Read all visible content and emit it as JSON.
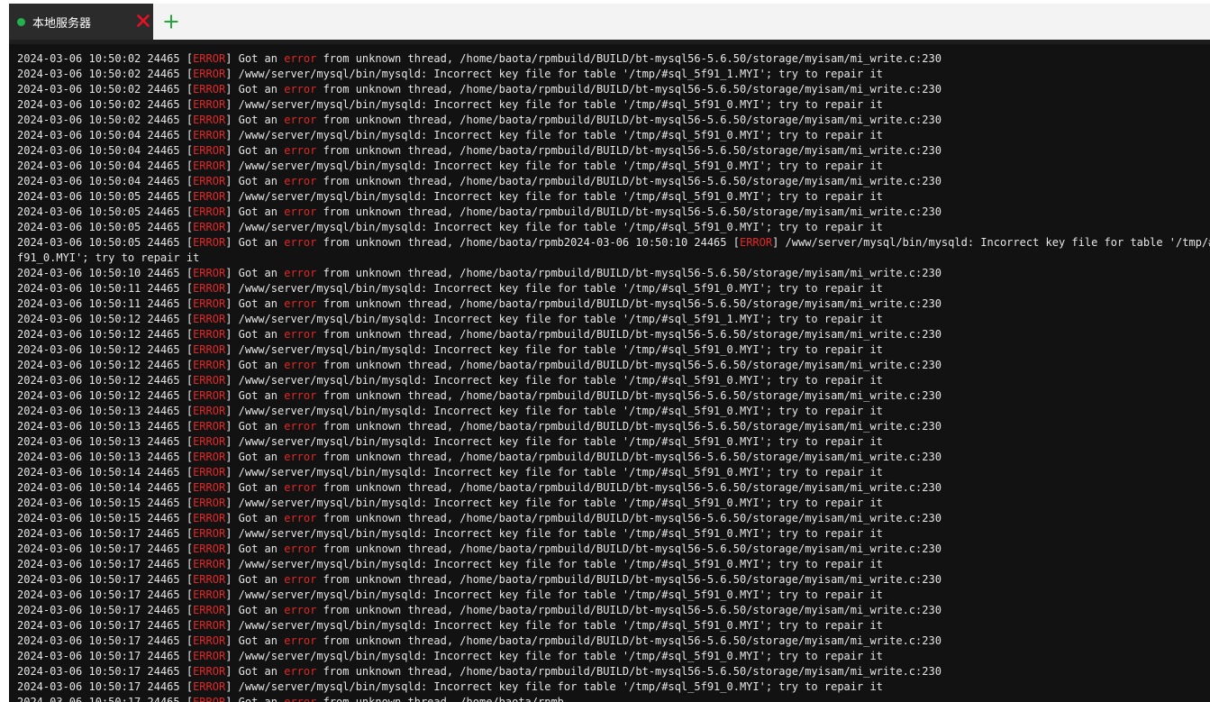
{
  "tab": {
    "label": "本地服务器",
    "status_color": "#22b14c",
    "close_icon": "close-icon",
    "add_icon": "plus-icon"
  },
  "colors": {
    "terminal_bg": "#121212",
    "text": "#e6e6e6",
    "error_red": "#e02828"
  },
  "lines": [
    [
      "2024-03-06 10:50:02 24465 [",
      {
        "r": "ERROR"
      },
      "] Got an ",
      {
        "r": "error"
      },
      " from unknown thread, /home/baota/rpmbuild/BUILD/bt-mysql56-5.6.50/storage/myisam/mi_write.c:230"
    ],
    [
      "2024-03-06 10:50:02 24465 [",
      {
        "r": "ERROR"
      },
      "] /www/server/mysql/bin/mysqld: Incorrect key file for table '/tmp/#sql_5f91_1.MYI'; try to repair it"
    ],
    [
      "2024-03-06 10:50:02 24465 [",
      {
        "r": "ERROR"
      },
      "] Got an ",
      {
        "r": "error"
      },
      " from unknown thread, /home/baota/rpmbuild/BUILD/bt-mysql56-5.6.50/storage/myisam/mi_write.c:230"
    ],
    [
      "2024-03-06 10:50:02 24465 [",
      {
        "r": "ERROR"
      },
      "] /www/server/mysql/bin/mysqld: Incorrect key file for table '/tmp/#sql_5f91_0.MYI'; try to repair it"
    ],
    [
      "2024-03-06 10:50:02 24465 [",
      {
        "r": "ERROR"
      },
      "] Got an ",
      {
        "r": "error"
      },
      " from unknown thread, /home/baota/rpmbuild/BUILD/bt-mysql56-5.6.50/storage/myisam/mi_write.c:230"
    ],
    [
      "2024-03-06 10:50:04 24465 [",
      {
        "r": "ERROR"
      },
      "] /www/server/mysql/bin/mysqld: Incorrect key file for table '/tmp/#sql_5f91_0.MYI'; try to repair it"
    ],
    [
      "2024-03-06 10:50:04 24465 [",
      {
        "r": "ERROR"
      },
      "] Got an ",
      {
        "r": "error"
      },
      " from unknown thread, /home/baota/rpmbuild/BUILD/bt-mysql56-5.6.50/storage/myisam/mi_write.c:230"
    ],
    [
      "2024-03-06 10:50:04 24465 [",
      {
        "r": "ERROR"
      },
      "] /www/server/mysql/bin/mysqld: Incorrect key file for table '/tmp/#sql_5f91_0.MYI'; try to repair it"
    ],
    [
      "2024-03-06 10:50:04 24465 [",
      {
        "r": "ERROR"
      },
      "] Got an ",
      {
        "r": "error"
      },
      " from unknown thread, /home/baota/rpmbuild/BUILD/bt-mysql56-5.6.50/storage/myisam/mi_write.c:230"
    ],
    [
      "2024-03-06 10:50:05 24465 [",
      {
        "r": "ERROR"
      },
      "] /www/server/mysql/bin/mysqld: Incorrect key file for table '/tmp/#sql_5f91_0.MYI'; try to repair it"
    ],
    [
      "2024-03-06 10:50:05 24465 [",
      {
        "r": "ERROR"
      },
      "] Got an ",
      {
        "r": "error"
      },
      " from unknown thread, /home/baota/rpmbuild/BUILD/bt-mysql56-5.6.50/storage/myisam/mi_write.c:230"
    ],
    [
      "2024-03-06 10:50:05 24465 [",
      {
        "r": "ERROR"
      },
      "] /www/server/mysql/bin/mysqld: Incorrect key file for table '/tmp/#sql_5f91_0.MYI'; try to repair it"
    ],
    [
      "2024-03-06 10:50:05 24465 [",
      {
        "r": "ERROR"
      },
      "] Got an ",
      {
        "r": "error"
      },
      " from unknown thread, /home/baota/rpmb2024-03-06 10:50:10 24465 [",
      {
        "r": "ERROR"
      },
      "] /www/server/mysql/bin/mysqld: Incorrect key file for table '/tmp/#sql_5"
    ],
    [
      "f91_0.MYI'; try to repair it"
    ],
    [
      "2024-03-06 10:50:10 24465 [",
      {
        "r": "ERROR"
      },
      "] Got an ",
      {
        "r": "error"
      },
      " from unknown thread, /home/baota/rpmbuild/BUILD/bt-mysql56-5.6.50/storage/myisam/mi_write.c:230"
    ],
    [
      "2024-03-06 10:50:11 24465 [",
      {
        "r": "ERROR"
      },
      "] /www/server/mysql/bin/mysqld: Incorrect key file for table '/tmp/#sql_5f91_0.MYI'; try to repair it"
    ],
    [
      "2024-03-06 10:50:11 24465 [",
      {
        "r": "ERROR"
      },
      "] Got an ",
      {
        "r": "error"
      },
      " from unknown thread, /home/baota/rpmbuild/BUILD/bt-mysql56-5.6.50/storage/myisam/mi_write.c:230"
    ],
    [
      "2024-03-06 10:50:12 24465 [",
      {
        "r": "ERROR"
      },
      "] /www/server/mysql/bin/mysqld: Incorrect key file for table '/tmp/#sql_5f91_1.MYI'; try to repair it"
    ],
    [
      "2024-03-06 10:50:12 24465 [",
      {
        "r": "ERROR"
      },
      "] Got an ",
      {
        "r": "error"
      },
      " from unknown thread, /home/baota/rpmbuild/BUILD/bt-mysql56-5.6.50/storage/myisam/mi_write.c:230"
    ],
    [
      "2024-03-06 10:50:12 24465 [",
      {
        "r": "ERROR"
      },
      "] /www/server/mysql/bin/mysqld: Incorrect key file for table '/tmp/#sql_5f91_0.MYI'; try to repair it"
    ],
    [
      "2024-03-06 10:50:12 24465 [",
      {
        "r": "ERROR"
      },
      "] Got an ",
      {
        "r": "error"
      },
      " from unknown thread, /home/baota/rpmbuild/BUILD/bt-mysql56-5.6.50/storage/myisam/mi_write.c:230"
    ],
    [
      "2024-03-06 10:50:12 24465 [",
      {
        "r": "ERROR"
      },
      "] /www/server/mysql/bin/mysqld: Incorrect key file for table '/tmp/#sql_5f91_0.MYI'; try to repair it"
    ],
    [
      "2024-03-06 10:50:12 24465 [",
      {
        "r": "ERROR"
      },
      "] Got an ",
      {
        "r": "error"
      },
      " from unknown thread, /home/baota/rpmbuild/BUILD/bt-mysql56-5.6.50/storage/myisam/mi_write.c:230"
    ],
    [
      "2024-03-06 10:50:13 24465 [",
      {
        "r": "ERROR"
      },
      "] /www/server/mysql/bin/mysqld: Incorrect key file for table '/tmp/#sql_5f91_0.MYI'; try to repair it"
    ],
    [
      "2024-03-06 10:50:13 24465 [",
      {
        "r": "ERROR"
      },
      "] Got an ",
      {
        "r": "error"
      },
      " from unknown thread, /home/baota/rpmbuild/BUILD/bt-mysql56-5.6.50/storage/myisam/mi_write.c:230"
    ],
    [
      "2024-03-06 10:50:13 24465 [",
      {
        "r": "ERROR"
      },
      "] /www/server/mysql/bin/mysqld: Incorrect key file for table '/tmp/#sql_5f91_0.MYI'; try to repair it"
    ],
    [
      "2024-03-06 10:50:13 24465 [",
      {
        "r": "ERROR"
      },
      "] Got an ",
      {
        "r": "error"
      },
      " from unknown thread, /home/baota/rpmbuild/BUILD/bt-mysql56-5.6.50/storage/myisam/mi_write.c:230"
    ],
    [
      "2024-03-06 10:50:14 24465 [",
      {
        "r": "ERROR"
      },
      "] /www/server/mysql/bin/mysqld: Incorrect key file for table '/tmp/#sql_5f91_0.MYI'; try to repair it"
    ],
    [
      "2024-03-06 10:50:14 24465 [",
      {
        "r": "ERROR"
      },
      "] Got an ",
      {
        "r": "error"
      },
      " from unknown thread, /home/baota/rpmbuild/BUILD/bt-mysql56-5.6.50/storage/myisam/mi_write.c:230"
    ],
    [
      "2024-03-06 10:50:15 24465 [",
      {
        "r": "ERROR"
      },
      "] /www/server/mysql/bin/mysqld: Incorrect key file for table '/tmp/#sql_5f91_0.MYI'; try to repair it"
    ],
    [
      "2024-03-06 10:50:15 24465 [",
      {
        "r": "ERROR"
      },
      "] Got an ",
      {
        "r": "error"
      },
      " from unknown thread, /home/baota/rpmbuild/BUILD/bt-mysql56-5.6.50/storage/myisam/mi_write.c:230"
    ],
    [
      "2024-03-06 10:50:17 24465 [",
      {
        "r": "ERROR"
      },
      "] /www/server/mysql/bin/mysqld: Incorrect key file for table '/tmp/#sql_5f91_0.MYI'; try to repair it"
    ],
    [
      "2024-03-06 10:50:17 24465 [",
      {
        "r": "ERROR"
      },
      "] Got an ",
      {
        "r": "error"
      },
      " from unknown thread, /home/baota/rpmbuild/BUILD/bt-mysql56-5.6.50/storage/myisam/mi_write.c:230"
    ],
    [
      "2024-03-06 10:50:17 24465 [",
      {
        "r": "ERROR"
      },
      "] /www/server/mysql/bin/mysqld: Incorrect key file for table '/tmp/#sql_5f91_0.MYI'; try to repair it"
    ],
    [
      "2024-03-06 10:50:17 24465 [",
      {
        "r": "ERROR"
      },
      "] Got an ",
      {
        "r": "error"
      },
      " from unknown thread, /home/baota/rpmbuild/BUILD/bt-mysql56-5.6.50/storage/myisam/mi_write.c:230"
    ],
    [
      "2024-03-06 10:50:17 24465 [",
      {
        "r": "ERROR"
      },
      "] /www/server/mysql/bin/mysqld: Incorrect key file for table '/tmp/#sql_5f91_0.MYI'; try to repair it"
    ],
    [
      "2024-03-06 10:50:17 24465 [",
      {
        "r": "ERROR"
      },
      "] Got an ",
      {
        "r": "error"
      },
      " from unknown thread, /home/baota/rpmbuild/BUILD/bt-mysql56-5.6.50/storage/myisam/mi_write.c:230"
    ],
    [
      "2024-03-06 10:50:17 24465 [",
      {
        "r": "ERROR"
      },
      "] /www/server/mysql/bin/mysqld: Incorrect key file for table '/tmp/#sql_5f91_0.MYI'; try to repair it"
    ],
    [
      "2024-03-06 10:50:17 24465 [",
      {
        "r": "ERROR"
      },
      "] Got an ",
      {
        "r": "error"
      },
      " from unknown thread, /home/baota/rpmbuild/BUILD/bt-mysql56-5.6.50/storage/myisam/mi_write.c:230"
    ],
    [
      "2024-03-06 10:50:17 24465 [",
      {
        "r": "ERROR"
      },
      "] /www/server/mysql/bin/mysqld: Incorrect key file for table '/tmp/#sql_5f91_0.MYI'; try to repair it"
    ],
    [
      "2024-03-06 10:50:17 24465 [",
      {
        "r": "ERROR"
      },
      "] Got an ",
      {
        "r": "error"
      },
      " from unknown thread, /home/baota/rpmbuild/BUILD/bt-mysql56-5.6.50/storage/myisam/mi_write.c:230"
    ],
    [
      "2024-03-06 10:50:17 24465 [",
      {
        "r": "ERROR"
      },
      "] /www/server/mysql/bin/mysqld: Incorrect key file for table '/tmp/#sql_5f91_0.MYI'; try to repair it"
    ],
    [
      "2024-03-06 10:50:17 24465 [",
      {
        "r": "ERROR"
      },
      "] Got an ",
      {
        "r": "error"
      },
      " from unknown thread, /home/baota/rpmb"
    ]
  ]
}
